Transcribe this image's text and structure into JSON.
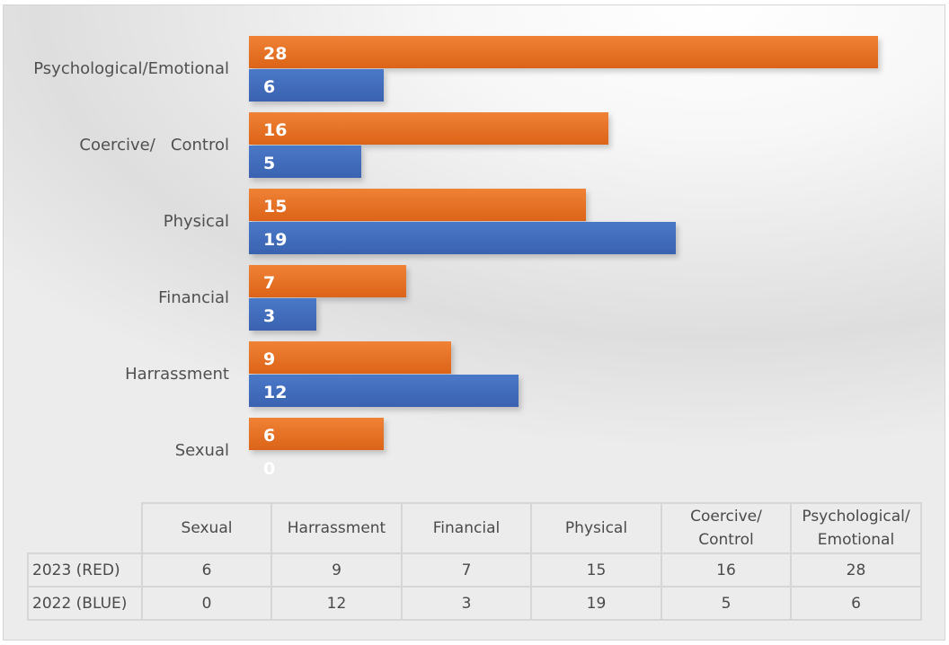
{
  "chart_data": {
    "type": "bar",
    "orientation": "horizontal",
    "title": "",
    "xlabel": "",
    "ylabel": "",
    "categories": [
      "Sexual",
      "Harrassment",
      "Financial",
      "Physical",
      "Coercive/   Control",
      "Psychological/Emotional"
    ],
    "series": [
      {
        "name": "2023 (RED)",
        "color": "#e8702a",
        "values": [
          6,
          9,
          7,
          15,
          16,
          28
        ]
      },
      {
        "name": "2022 (BLUE)",
        "color": "#4472c4",
        "values": [
          0,
          12,
          3,
          19,
          5,
          6
        ]
      }
    ],
    "xlim": [
      0,
      28
    ],
    "grid": false,
    "data_labels": true,
    "legend": "none (data table below chart)"
  },
  "table": {
    "headers": [
      "",
      "Sexual",
      "Harrassment",
      "Financial",
      "Physical",
      "Coercive/\nControl",
      "Psychological/\nEmotional"
    ],
    "rows": [
      {
        "label": "2023 (RED)",
        "values": [
          "6",
          "9",
          "7",
          "15",
          "16",
          "28"
        ]
      },
      {
        "label": "2022 (BLUE)",
        "values": [
          "0",
          "12",
          "3",
          "19",
          "5",
          "6"
        ]
      }
    ]
  }
}
